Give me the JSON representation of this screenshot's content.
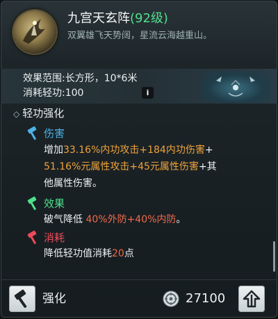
{
  "skill": {
    "name": "九宫天玄阵",
    "level": "(92级)",
    "description": "双翼雄飞天势阔，星流云海越重山。"
  },
  "info": {
    "range_label": "效果范围:",
    "range_value": "长方形，10*6米",
    "cost_label": "消耗轻功:",
    "cost_value": "100",
    "badge": "i"
  },
  "section": {
    "title": "轻功强化"
  },
  "entries": [
    {
      "icon": "hammer-icon",
      "head": "伤害",
      "head_color": "#4fb2e6",
      "lines": [
        [
          "增加",
          "33.16%内功攻击+184内功伤害",
          "+"
        ],
        [
          "51.16%元属性攻击+45元属性伤害",
          "+其"
        ],
        [
          "他属性伤害。"
        ]
      ]
    },
    {
      "icon": "hammer-icon",
      "head": "效果",
      "head_color": "#4fe08c",
      "lines": [
        [
          "破气降低 ",
          "40%外防+40%内防",
          "。"
        ]
      ]
    },
    {
      "icon": "hammer-icon",
      "head": "消耗",
      "head_color": "#ef4a5a",
      "lines": [
        [
          "降低轻功值消耗",
          "20",
          "点"
        ]
      ]
    }
  ],
  "footer": {
    "upgrade_label": "强化",
    "cost": "27100",
    "confirm_icon": "arrow-up-icon",
    "currency_icon": "coin-icon"
  },
  "colors": {
    "level_green": "#4fe08c",
    "highlight_orange": "#f0a23a",
    "highlight_red": "#f06a4a"
  }
}
